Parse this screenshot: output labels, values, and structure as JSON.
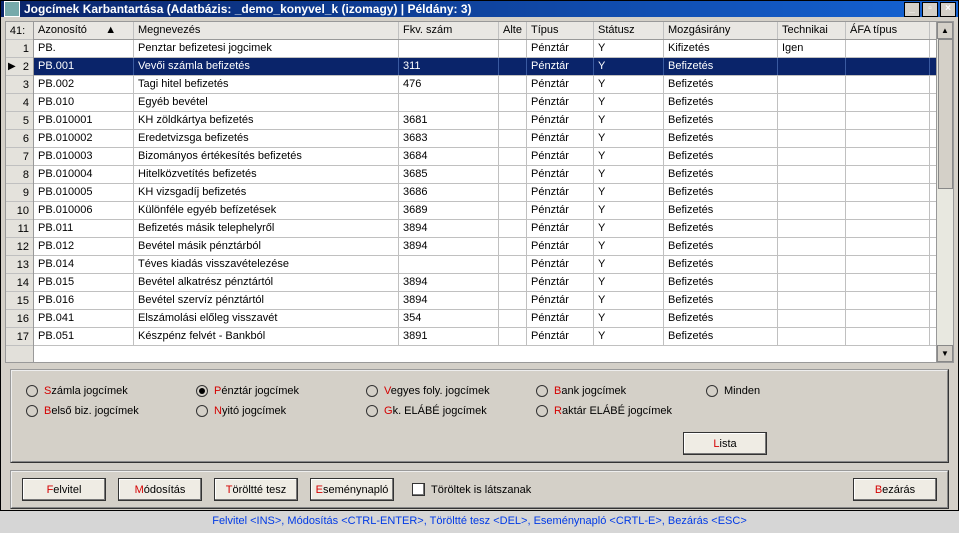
{
  "title": "Jogcímek Karbantartása   (Adatbázis: _demo_konyvel_k (izomagy) | Példány: 3)",
  "corner_header": "41:",
  "columns": {
    "azonosito": "Azonosító",
    "megnevezes": "Megnevezés",
    "fkv": "Fkv. szám",
    "alt": "Alte",
    "tipus": "Típus",
    "statusz": "Státusz",
    "mozg": "Mozgásirány",
    "tech": "Technikai",
    "afa": "ÁFA típus",
    "azon_sort": "▲"
  },
  "rows": [
    {
      "n": "1",
      "az": "PB.",
      "meg": "Penztar befizetesi jogcimek",
      "fkv": "",
      "alt": "",
      "tip": "Pénztár",
      "st": "Y",
      "mozg": "Kifizetés",
      "tech": "Igen",
      "afa": ""
    },
    {
      "n": "2",
      "az": "PB.001",
      "meg": "Vevői számla befizetés",
      "fkv": "311",
      "alt": "",
      "tip": "Pénztár",
      "st": "Y",
      "mozg": "Befizetés",
      "tech": "",
      "afa": "",
      "selected": true,
      "ptr": "▶"
    },
    {
      "n": "3",
      "az": "PB.002",
      "meg": "Tagi hitel befizetés",
      "fkv": "476",
      "alt": "",
      "tip": "Pénztár",
      "st": "Y",
      "mozg": "Befizetés",
      "tech": "",
      "afa": ""
    },
    {
      "n": "4",
      "az": "PB.010",
      "meg": "Egyéb bevétel",
      "fkv": "",
      "alt": "",
      "tip": "Pénztár",
      "st": "Y",
      "mozg": "Befizetés",
      "tech": "",
      "afa": ""
    },
    {
      "n": "5",
      "az": "PB.010001",
      "meg": "KH zöldkártya befizetés",
      "fkv": "3681",
      "alt": "",
      "tip": "Pénztár",
      "st": "Y",
      "mozg": "Befizetés",
      "tech": "",
      "afa": ""
    },
    {
      "n": "6",
      "az": "PB.010002",
      "meg": "Eredetvizsga befizetés",
      "fkv": "3683",
      "alt": "",
      "tip": "Pénztár",
      "st": "Y",
      "mozg": "Befizetés",
      "tech": "",
      "afa": ""
    },
    {
      "n": "7",
      "az": "PB.010003",
      "meg": "Bizományos értékesítés befizetés",
      "fkv": "3684",
      "alt": "",
      "tip": "Pénztár",
      "st": "Y",
      "mozg": "Befizetés",
      "tech": "",
      "afa": ""
    },
    {
      "n": "8",
      "az": "PB.010004",
      "meg": "Hitelközvetítés befizetés",
      "fkv": "3685",
      "alt": "",
      "tip": "Pénztár",
      "st": "Y",
      "mozg": "Befizetés",
      "tech": "",
      "afa": ""
    },
    {
      "n": "9",
      "az": "PB.010005",
      "meg": "KH vizsgadíj befizetés",
      "fkv": "3686",
      "alt": "",
      "tip": "Pénztár",
      "st": "Y",
      "mozg": "Befizetés",
      "tech": "",
      "afa": ""
    },
    {
      "n": "10",
      "az": "PB.010006",
      "meg": "Különféle egyéb befízetések",
      "fkv": "3689",
      "alt": "",
      "tip": "Pénztár",
      "st": "Y",
      "mozg": "Befizetés",
      "tech": "",
      "afa": ""
    },
    {
      "n": "11",
      "az": "PB.011",
      "meg": "Befizetés másik telephelyről",
      "fkv": "3894",
      "alt": "",
      "tip": "Pénztár",
      "st": "Y",
      "mozg": "Befizetés",
      "tech": "",
      "afa": ""
    },
    {
      "n": "12",
      "az": "PB.012",
      "meg": "Bevétel másik pénztárból",
      "fkv": "3894",
      "alt": "",
      "tip": "Pénztár",
      "st": "Y",
      "mozg": "Befizetés",
      "tech": "",
      "afa": ""
    },
    {
      "n": "13",
      "az": "PB.014",
      "meg": "Téves kiadás visszavételezése",
      "fkv": "",
      "alt": "",
      "tip": "Pénztár",
      "st": "Y",
      "mozg": "Befizetés",
      "tech": "",
      "afa": ""
    },
    {
      "n": "14",
      "az": "PB.015",
      "meg": "Bevétel alkatrész pénztártól",
      "fkv": "3894",
      "alt": "",
      "tip": "Pénztár",
      "st": "Y",
      "mozg": "Befizetés",
      "tech": "",
      "afa": ""
    },
    {
      "n": "15",
      "az": "PB.016",
      "meg": "Bevétel szervíz pénztártól",
      "fkv": "3894",
      "alt": "",
      "tip": "Pénztár",
      "st": "Y",
      "mozg": "Befizetés",
      "tech": "",
      "afa": ""
    },
    {
      "n": "16",
      "az": "PB.041",
      "meg": "Elszámolási előleg visszavét",
      "fkv": "354",
      "alt": "",
      "tip": "Pénztár",
      "st": "Y",
      "mozg": "Befizetés",
      "tech": "",
      "afa": ""
    },
    {
      "n": "17",
      "az": "PB.051",
      "meg": "Készpénz felvét - Bankból",
      "fkv": "3891",
      "alt": "",
      "tip": "Pénztár",
      "st": "Y",
      "mozg": "Befizetés",
      "tech": "",
      "afa": ""
    }
  ],
  "radios": {
    "szamla": {
      "hot": "S",
      "rest": "zámla jogcímek"
    },
    "penztar": {
      "hot": "P",
      "rest": "énztár jogcímek"
    },
    "vegyes": {
      "hot": "V",
      "rest": "egyes foly. jogcímek"
    },
    "bank": {
      "hot": "B",
      "rest": "ank jogcímek"
    },
    "minden": {
      "hot": "",
      "rest": "Minden"
    },
    "belso": {
      "hot": "B",
      "rest": "első biz. jogcímek"
    },
    "nyito": {
      "hot": "N",
      "rest": "yitó jogcímek"
    },
    "gk": {
      "hot": "G",
      "rest": "k. ELÁBÉ jogcímek"
    },
    "raktar": {
      "hot": "R",
      "rest": "aktár ELÁBÉ jogcímek"
    }
  },
  "lista": {
    "hot": "L",
    "rest": "ista"
  },
  "buttons": {
    "felvitel": {
      "hot": "F",
      "rest": "elvitel"
    },
    "modositas": {
      "hot": "M",
      "rest": "ódosítás"
    },
    "torolte": {
      "hot": "T",
      "rest": "öröltté tesz"
    },
    "esemeny": {
      "hot": "E",
      "rest": "seménynapló"
    },
    "bezaras": {
      "hot": "B",
      "rest": "ezárás"
    }
  },
  "chk": {
    "hot": "T",
    "rest": "öröltek is látszanak"
  },
  "footer": "Felvitel <INS>,  Módosítás <CTRL-ENTER>,  Töröltté tesz <DEL>,  Eseménynapló <CRTL-E>,  Bezárás <ESC>"
}
